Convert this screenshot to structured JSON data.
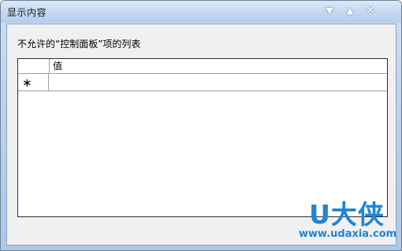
{
  "window": {
    "title": "显示内容",
    "controls": {
      "down_glyph": "▼",
      "up_glyph": "▲",
      "close_glyph": "✕"
    }
  },
  "content": {
    "caption": "不允许的“控制面板”项的列表",
    "table": {
      "columns": [
        "值"
      ],
      "new_row_marker": "∗",
      "rows": []
    }
  },
  "watermark": {
    "logo_text": "U大侠",
    "url": "www.udaxia.com"
  },
  "colors": {
    "watermark": "#1e84d6",
    "titlebar": "#c3d7ef"
  }
}
